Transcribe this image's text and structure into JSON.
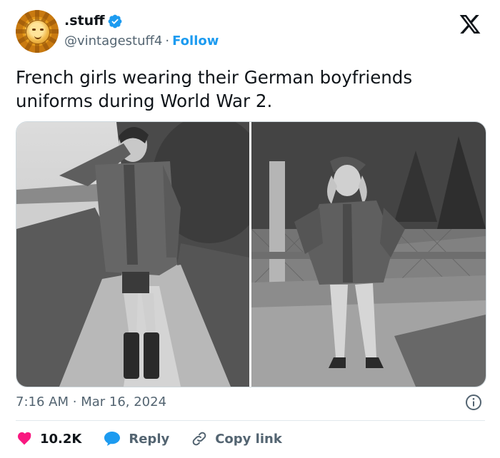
{
  "account": {
    "display_name": ".stuff",
    "handle": "@vintagestuff4",
    "separator": "·",
    "follow_label": "Follow"
  },
  "tweet": {
    "text": "French girls wearing their German boyfriends uniforms during World War 2.",
    "time": "7:16 AM",
    "date_separator": "·",
    "date": "Mar 16, 2024"
  },
  "actions": {
    "like_count": "10.2K",
    "reply_label": "Reply",
    "copy_link_label": "Copy link"
  },
  "colors": {
    "brand_blue": "#1d9bf0",
    "like_red": "#f91880",
    "text_primary": "#0f1419",
    "text_secondary": "#536471"
  },
  "icons": [
    "verified-badge-icon",
    "x-logo-icon",
    "info-icon",
    "heart-icon",
    "reply-bubble-icon",
    "link-icon"
  ]
}
